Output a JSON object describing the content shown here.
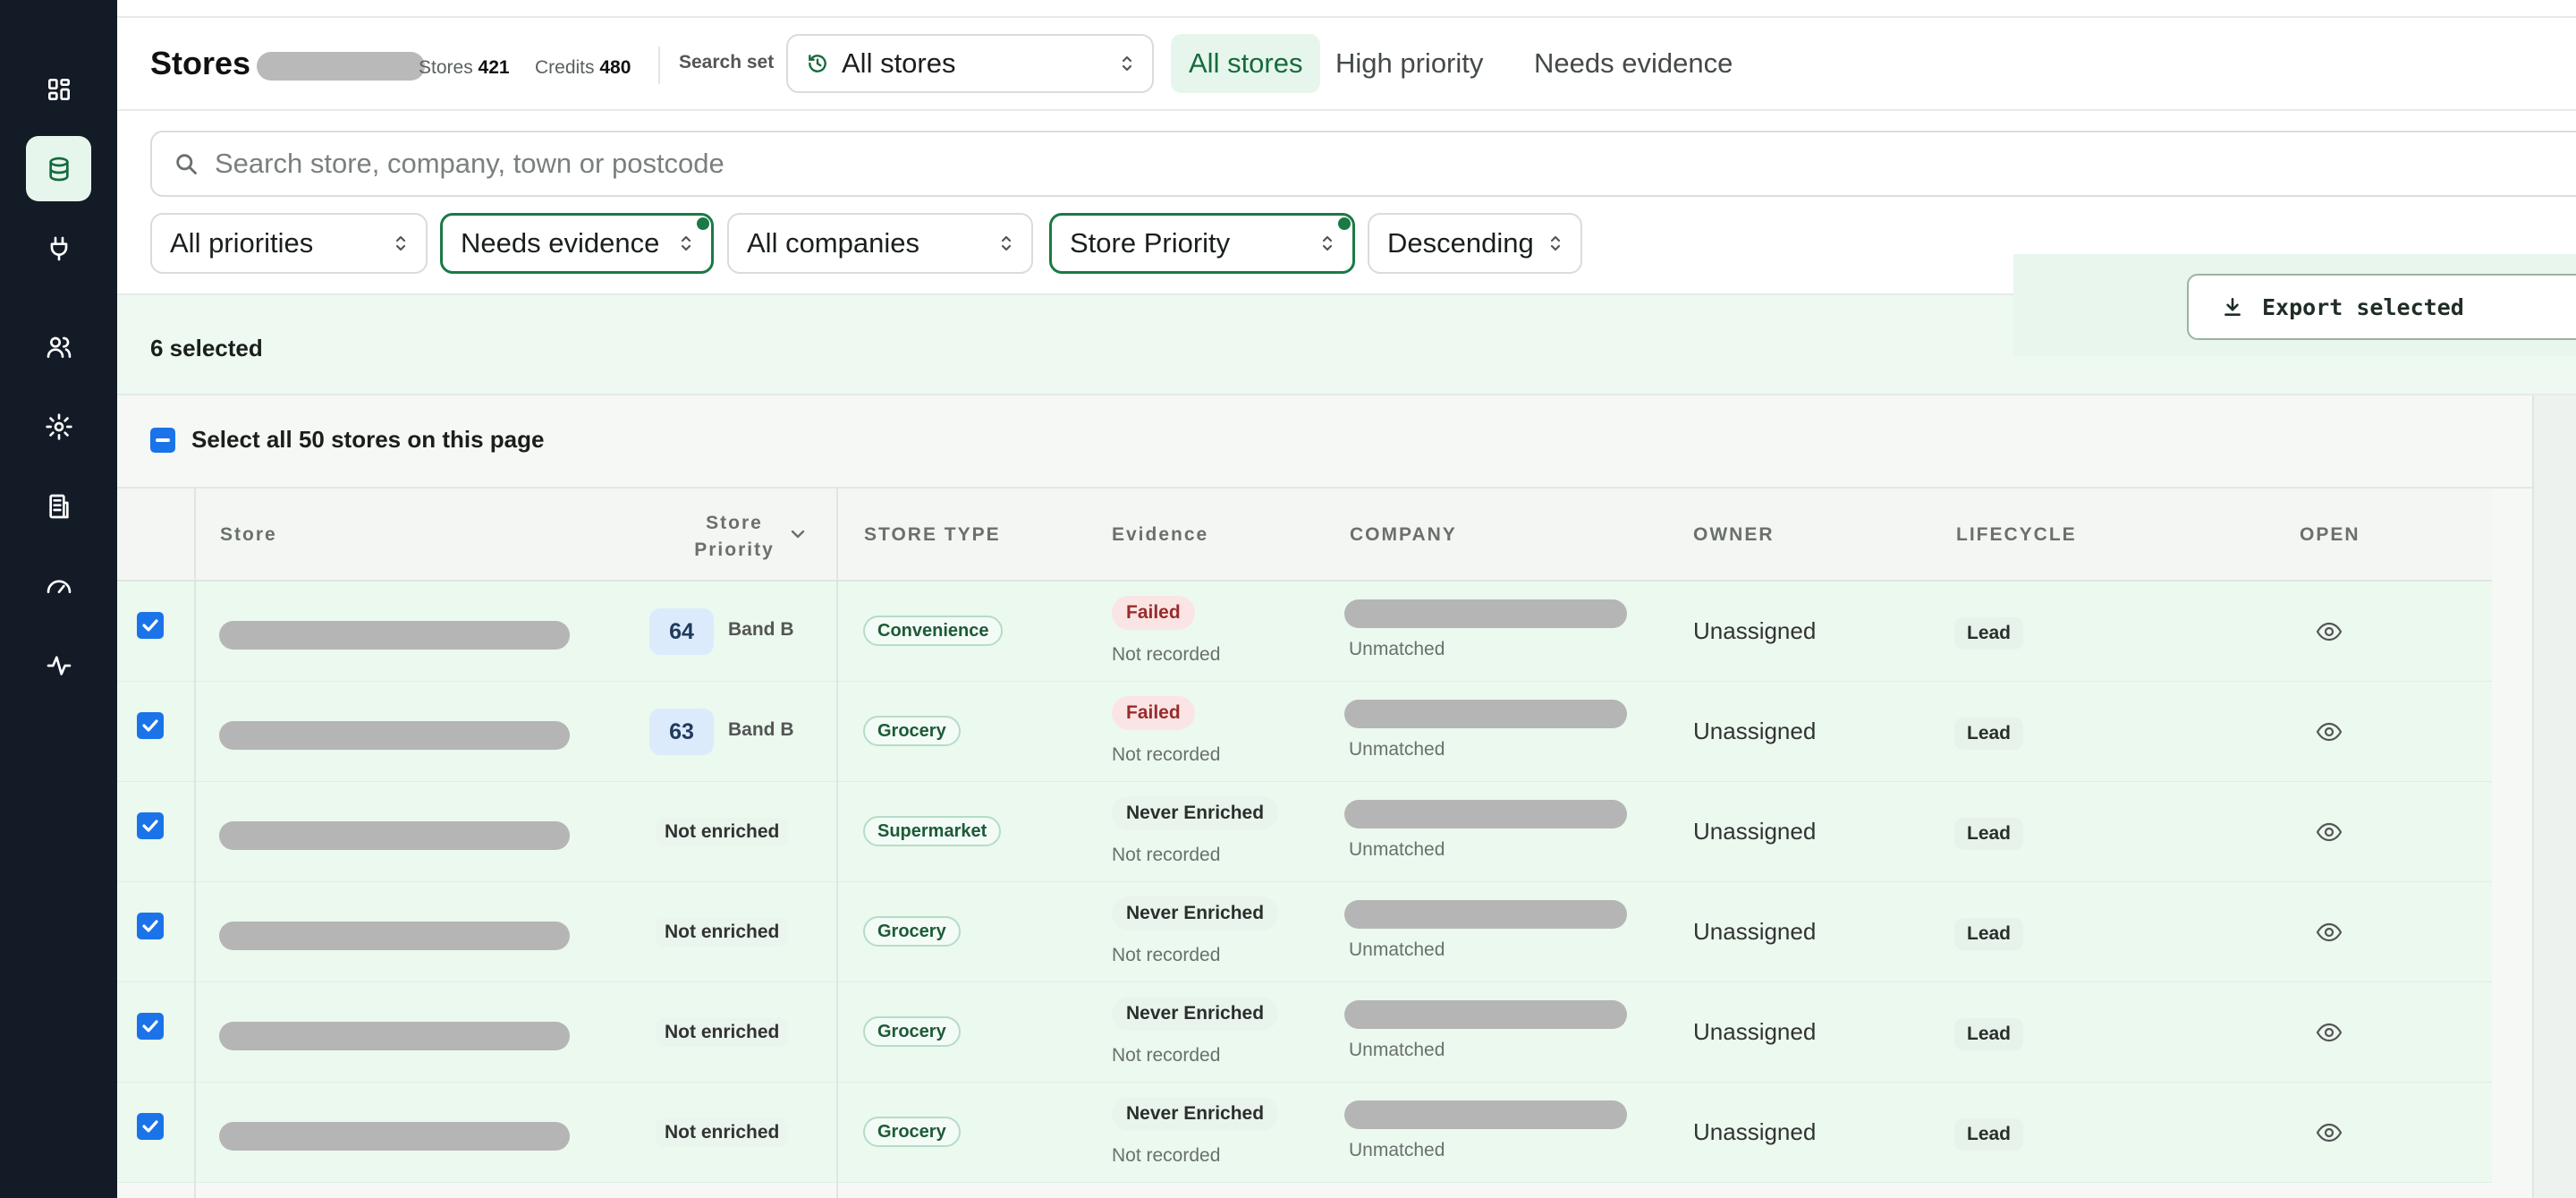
{
  "header": {
    "title": "Stores",
    "stores_label": "Stores",
    "stores_value": "421",
    "credits_label": "Credits",
    "credits_value": "480",
    "search_set_label": "Search set",
    "search_set_value": "All stores",
    "tabs": [
      {
        "label": "All stores",
        "active": true
      },
      {
        "label": "High priority",
        "active": false
      },
      {
        "label": "Needs evidence",
        "active": false
      }
    ]
  },
  "search": {
    "placeholder": "Search store, company, town or postcode"
  },
  "filters": [
    {
      "label": "All priorities",
      "active": false
    },
    {
      "label": "Needs evidence",
      "active": true
    },
    {
      "label": "All companies",
      "active": false
    },
    {
      "label": "Store Priority",
      "active": true
    },
    {
      "label": "Descending",
      "active": false
    }
  ],
  "selection": {
    "count_text": "6 selected",
    "export_label": "Export selected",
    "select_all_label": "Select all 50 stores on this page"
  },
  "table": {
    "columns": {
      "store": "Store",
      "priority_line1": "Store",
      "priority_line2": "Priority",
      "type": "STORE TYPE",
      "evidence": "Evidence",
      "company": "COMPANY",
      "owner": "OWNER",
      "lifecycle": "LIFECYCLE",
      "open": "OPEN"
    },
    "rows": [
      {
        "score": "64",
        "band": "Band B",
        "priority_text": "",
        "type": "Convenience",
        "evidence": "Failed",
        "evidence_note": "Not recorded",
        "company_note": "Unmatched",
        "owner": "Unassigned",
        "lifecycle": "Lead"
      },
      {
        "score": "63",
        "band": "Band B",
        "priority_text": "",
        "type": "Grocery",
        "evidence": "Failed",
        "evidence_note": "Not recorded",
        "company_note": "Unmatched",
        "owner": "Unassigned",
        "lifecycle": "Lead"
      },
      {
        "score": "",
        "band": "",
        "priority_text": "Not enriched",
        "type": "Supermarket",
        "evidence": "Never Enriched",
        "evidence_note": "Not recorded",
        "company_note": "Unmatched",
        "owner": "Unassigned",
        "lifecycle": "Lead"
      },
      {
        "score": "",
        "band": "",
        "priority_text": "Not enriched",
        "type": "Grocery",
        "evidence": "Never Enriched",
        "evidence_note": "Not recorded",
        "company_note": "Unmatched",
        "owner": "Unassigned",
        "lifecycle": "Lead"
      },
      {
        "score": "",
        "band": "",
        "priority_text": "Not enriched",
        "type": "Grocery",
        "evidence": "Never Enriched",
        "evidence_note": "Not recorded",
        "company_note": "Unmatched",
        "owner": "Unassigned",
        "lifecycle": "Lead"
      },
      {
        "score": "",
        "band": "",
        "priority_text": "Not enriched",
        "type": "Grocery",
        "evidence": "Never Enriched",
        "evidence_note": "Not recorded",
        "company_note": "Unmatched",
        "owner": "Unassigned",
        "lifecycle": "Lead"
      }
    ]
  },
  "colors": {
    "sidebar": "#121b26",
    "accent": "#166a3d",
    "selected_row": "#ebf9ef",
    "checkbox": "#1a73e8"
  },
  "icons": [
    "dashboard-icon",
    "database-icon",
    "plug-icon",
    "users-icon",
    "gear-icon",
    "building-icon",
    "gauge-icon",
    "activity-icon",
    "history-icon",
    "search-icon",
    "download-icon",
    "eye-icon",
    "chevron-updown-icon",
    "chevron-down-icon",
    "check-icon"
  ]
}
